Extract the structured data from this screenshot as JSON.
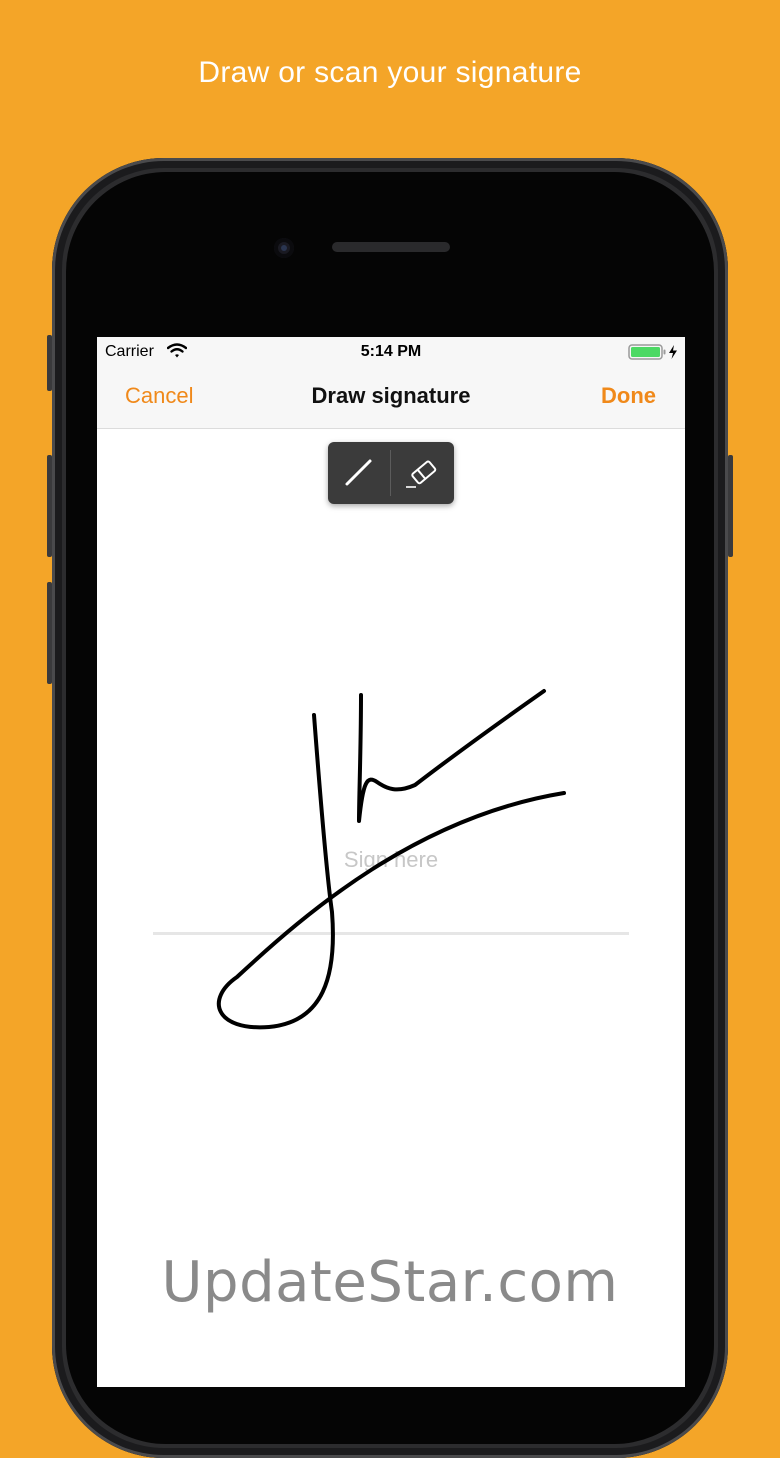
{
  "headline": "Draw or scan your signature",
  "status_bar": {
    "carrier": "Carrier",
    "time": "5:14 PM",
    "battery_color": "#4cd964"
  },
  "nav": {
    "cancel_label": "Cancel",
    "title": "Draw signature",
    "done_label": "Done",
    "accent_color": "#F0891A"
  },
  "toolbar": {
    "tools": [
      {
        "icon": "pen-icon",
        "selected": true
      },
      {
        "icon": "eraser-icon",
        "selected": false
      }
    ]
  },
  "canvas": {
    "placeholder": "Sign here"
  },
  "watermark": "UpdateStar.com",
  "colors": {
    "background": "#F4A528",
    "ink": "#000000"
  }
}
